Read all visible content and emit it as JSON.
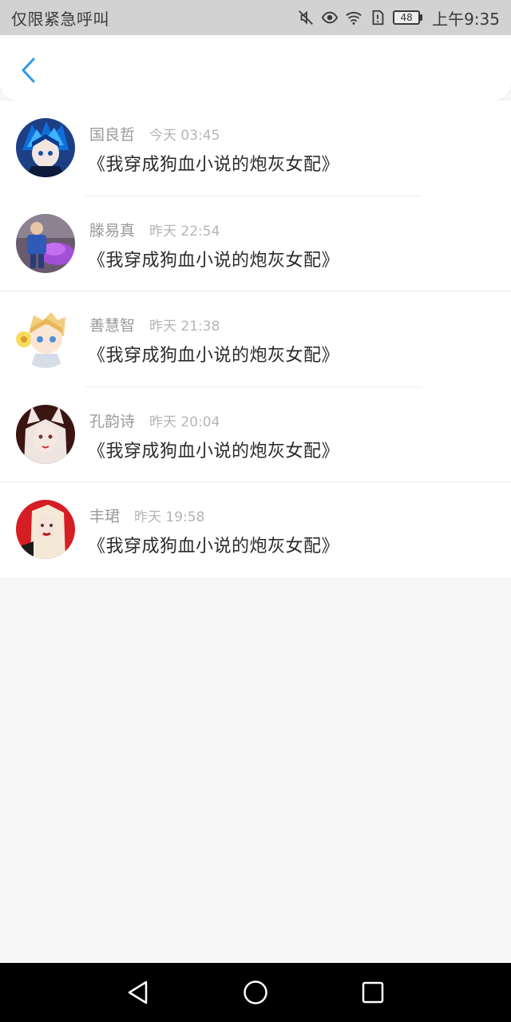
{
  "status_bar": {
    "carrier_text": "仅限紧急呼叫",
    "battery_level": "48",
    "time": "上午9:35",
    "icons": [
      "mute-icon",
      "eye-icon",
      "wifi-icon",
      "sim-alert-icon",
      "battery-icon"
    ]
  },
  "header": {
    "back_icon": "chevron-left-icon",
    "accent_color": "#2f9ae6"
  },
  "messages": [
    {
      "name": "国良哲",
      "time": "今天 03:45",
      "title": "《我穿成狗血小说的炮灰女配》",
      "avatar": "avatar-blue-hair-boy"
    },
    {
      "name": "滕易真",
      "time": "昨天 22:54",
      "title": "《我穿成狗血小说的炮灰女配》",
      "avatar": "avatar-child-flowers"
    },
    {
      "name": "善慧智",
      "time": "昨天 21:38",
      "title": "《我穿成狗血小说的炮灰女配》",
      "avatar": "avatar-blonde-cartoon"
    },
    {
      "name": "孔韵诗",
      "time": "昨天 20:04",
      "title": "《我穿成狗血小说的炮灰女配》",
      "avatar": "avatar-fox-girl"
    },
    {
      "name": "丰珺",
      "time": "昨天 19:58",
      "title": "《我穿成狗血小说的炮灰女配》",
      "avatar": "avatar-red-portrait"
    }
  ],
  "nav_bar": {
    "icons": [
      "back-triangle-icon",
      "home-circle-icon",
      "recents-square-icon"
    ]
  }
}
